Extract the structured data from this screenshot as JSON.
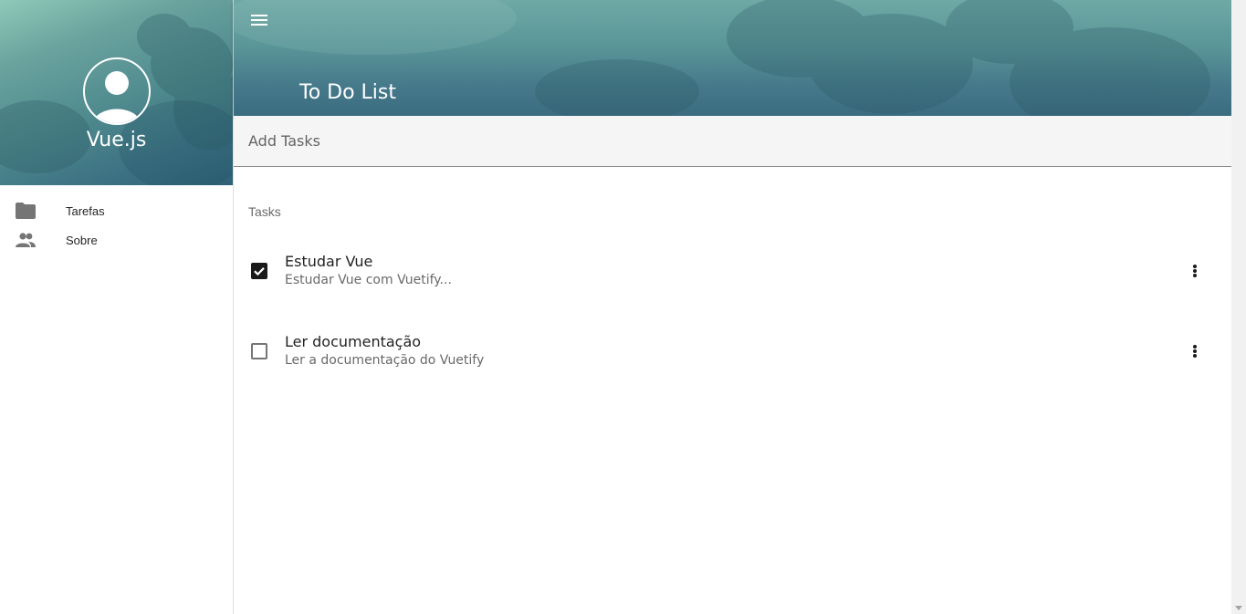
{
  "drawer": {
    "title": "Vue.js",
    "avatar_icon": "account-icon",
    "items": [
      {
        "icon": "folder-icon",
        "label": "Tarefas"
      },
      {
        "icon": "account-group-icon",
        "label": "Sobre"
      }
    ]
  },
  "appbar": {
    "menu_icon": "menu-icon",
    "title": "To Do List"
  },
  "add_task": {
    "placeholder": "Add Tasks",
    "value": ""
  },
  "tasks": {
    "subheader": "Tasks",
    "items": [
      {
        "title": "Estudar Vue",
        "description": "Estudar Vue com Vuetify...",
        "done": true
      },
      {
        "title": "Ler documentação",
        "description": "Ler a documentação do Vuetify",
        "done": false
      }
    ]
  },
  "colors": {
    "header_teal": "#4f8a8e",
    "checkbox_checked": "#1a1a1a"
  }
}
